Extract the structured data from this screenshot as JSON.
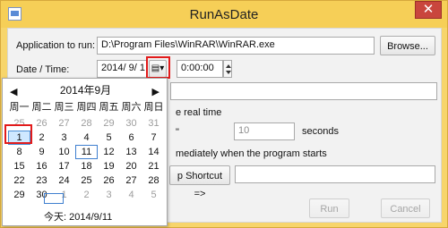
{
  "window": {
    "title": "RunAsDate",
    "close_glyph": "✕"
  },
  "fields": {
    "app_label": "Application to run:",
    "app_value": "D:\\Program Files\\WinRAR\\WinRAR.exe",
    "browse_label": "Browse...",
    "date_label": "Date / Time:",
    "date_value": "2014/  9/  1",
    "time_value": "0:00:00",
    "real_time_text": "e real time",
    "seconds_value": "10",
    "seconds_label": "seconds",
    "immediate_text": "mediately when the program starts",
    "shortcut_label": "p Shortcut =>",
    "mark_text": "\""
  },
  "calendar": {
    "month_label": "2014年9月",
    "weekdays": [
      "周一",
      "周二",
      "周三",
      "周四",
      "周五",
      "周六",
      "周日"
    ],
    "days": [
      {
        "d": "25",
        "gray": true
      },
      {
        "d": "26",
        "gray": true
      },
      {
        "d": "27",
        "gray": true
      },
      {
        "d": "28",
        "gray": true
      },
      {
        "d": "29",
        "gray": true
      },
      {
        "d": "30",
        "gray": true
      },
      {
        "d": "31",
        "gray": true
      },
      {
        "d": "1",
        "selected": true
      },
      {
        "d": "2"
      },
      {
        "d": "3"
      },
      {
        "d": "4"
      },
      {
        "d": "5"
      },
      {
        "d": "6"
      },
      {
        "d": "7"
      },
      {
        "d": "8"
      },
      {
        "d": "9"
      },
      {
        "d": "10"
      },
      {
        "d": "11",
        "today": true
      },
      {
        "d": "12"
      },
      {
        "d": "13"
      },
      {
        "d": "14"
      },
      {
        "d": "15"
      },
      {
        "d": "16"
      },
      {
        "d": "17"
      },
      {
        "d": "18"
      },
      {
        "d": "19"
      },
      {
        "d": "20"
      },
      {
        "d": "21"
      },
      {
        "d": "22"
      },
      {
        "d": "23"
      },
      {
        "d": "24"
      },
      {
        "d": "25"
      },
      {
        "d": "26"
      },
      {
        "d": "27"
      },
      {
        "d": "28"
      },
      {
        "d": "29"
      },
      {
        "d": "30"
      },
      {
        "d": "1",
        "gray": true
      },
      {
        "d": "2",
        "gray": true
      },
      {
        "d": "3",
        "gray": true
      },
      {
        "d": "4",
        "gray": true
      },
      {
        "d": "5",
        "gray": true
      }
    ],
    "today_label": "今天: 2014/9/11",
    "prev_glyph": "◀",
    "next_glyph": "▶"
  },
  "buttons": {
    "run_label": "Run",
    "cancel_label": "Cancel"
  }
}
